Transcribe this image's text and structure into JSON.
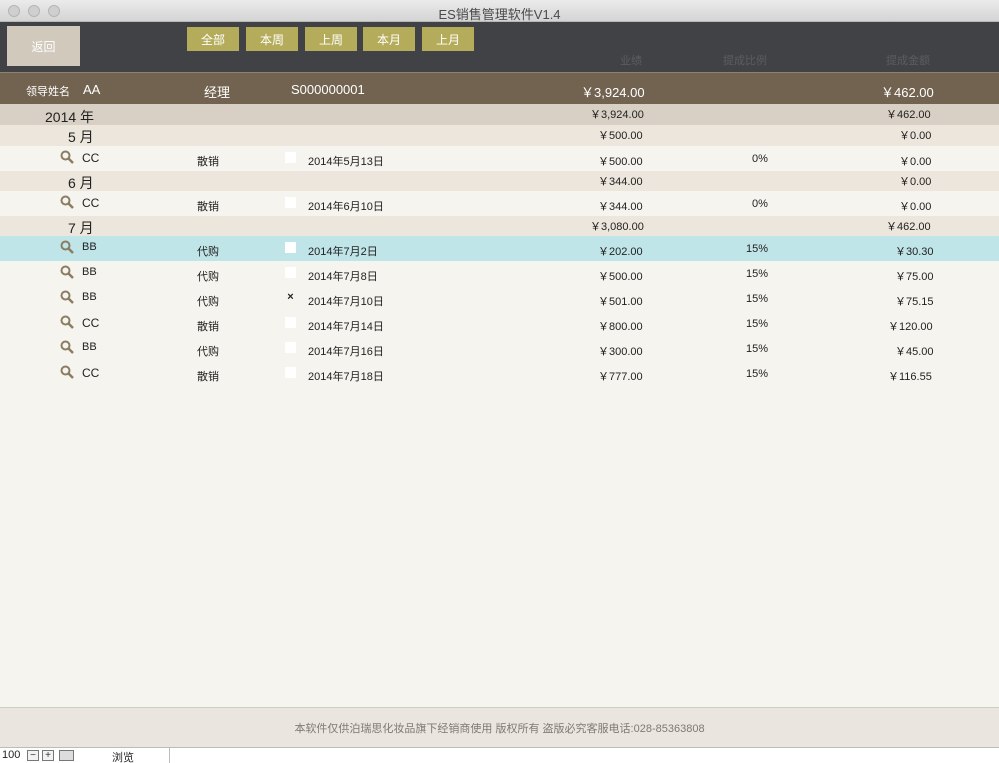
{
  "window": {
    "title": "ES销售管理软件V1.4"
  },
  "toolbar": {
    "back_label": "返回",
    "filters": [
      "全部",
      "本周",
      "上周",
      "本月",
      "上月"
    ],
    "col_headers": {
      "performance": "业绩",
      "commission_rate": "提成比例",
      "commission_amount": "提成金额"
    }
  },
  "leader": {
    "name_label": "领导姓名",
    "name": "AA",
    "role": "经理",
    "code": "S000000001",
    "performance": "￥3,924.00",
    "commission": "￥462.00"
  },
  "year": {
    "label": "2014 年",
    "performance": "￥3,924.00",
    "commission": "￥462.00"
  },
  "months": [
    {
      "label": "5 月",
      "performance": "￥500.00",
      "commission": "￥0.00",
      "rows": [
        {
          "name": "CC",
          "type": "散销",
          "checked": "",
          "date": "2014年5月13日",
          "amount": "￥500.00",
          "rate": "0%",
          "commission": "￥0.00"
        }
      ]
    },
    {
      "label": "6 月",
      "performance": "￥344.00",
      "commission": "￥0.00",
      "rows": [
        {
          "name": "CC",
          "type": "散销",
          "checked": "",
          "date": "2014年6月10日",
          "amount": "￥344.00",
          "rate": "0%",
          "commission": "￥0.00"
        }
      ]
    },
    {
      "label": "7 月",
      "performance": "￥3,080.00",
      "commission": "￥462.00",
      "rows": [
        {
          "name": "BB",
          "type": "代购",
          "checked": "",
          "date": "2014年7月2日",
          "amount": "￥202.00",
          "rate": "15%",
          "commission": "￥30.30"
        },
        {
          "name": "BB",
          "type": "代购",
          "checked": "",
          "date": "2014年7月8日",
          "amount": "￥500.00",
          "rate": "15%",
          "commission": "￥75.00"
        },
        {
          "name": "BB",
          "type": "代购",
          "checked": "×",
          "date": "2014年7月10日",
          "amount": "￥501.00",
          "rate": "15%",
          "commission": "￥75.15"
        },
        {
          "name": "CC",
          "type": "散销",
          "checked": "",
          "date": "2014年7月14日",
          "amount": "￥800.00",
          "rate": "15%",
          "commission": "￥120.00"
        },
        {
          "name": "BB",
          "type": "代购",
          "checked": "",
          "date": "2014年7月16日",
          "amount": "￥300.00",
          "rate": "15%",
          "commission": "￥45.00"
        },
        {
          "name": "CC",
          "type": "散销",
          "checked": "",
          "date": "2014年7月18日",
          "amount": "￥777.00",
          "rate": "15%",
          "commission": "￥116.55"
        }
      ]
    }
  ],
  "footer": {
    "text": "本软件仅供泊瑞思化妆品旗下经销商使用 版权所有 盗版必究客服电话:028-85363808"
  },
  "statusbar": {
    "zoom": "100",
    "mode": "浏览"
  }
}
